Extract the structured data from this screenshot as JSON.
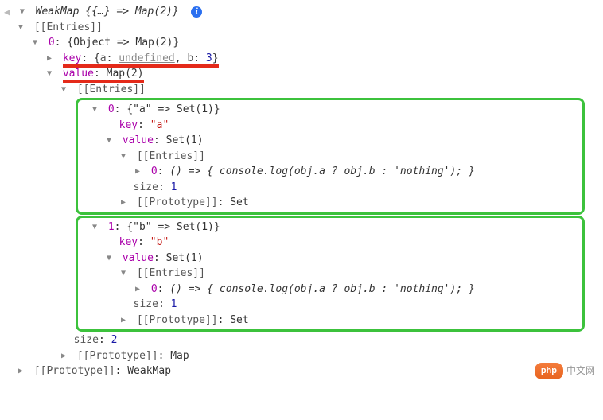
{
  "root": {
    "header": "WeakMap {{…} => Map(2)}",
    "entries_label": "[[Entries]]",
    "entry0_header": "{Object => Map(2)}",
    "key_label": "key",
    "key_preview_a": "a",
    "key_preview_und": "undefined",
    "key_preview_b": "b",
    "key_preview_bv": "3",
    "value_label": "value",
    "value_preview": "Map(2)",
    "nested": {
      "entries_label": "[[Entries]]",
      "e0": {
        "header": "{\"a\" => Set(1)}",
        "key_label": "key",
        "key_val": "\"a\"",
        "value_label": "value",
        "value_preview": "Set(1)",
        "entries_label": "[[Entries]]",
        "idx": "0",
        "fn": "() => { console.log(obj.a ? obj.b : 'nothing'); }",
        "size_label": "size",
        "size_val": "1",
        "proto_label": "[[Prototype]]",
        "proto_val": "Set"
      },
      "e1": {
        "header": "{\"b\" => Set(1)}",
        "key_label": "key",
        "key_val": "\"b\"",
        "value_label": "value",
        "value_preview": "Set(1)",
        "entries_label": "[[Entries]]",
        "idx": "0",
        "fn": "() => { console.log(obj.a ? obj.b : 'nothing'); }",
        "size_label": "size",
        "size_val": "1",
        "proto_label": "[[Prototype]]",
        "proto_val": "Set"
      },
      "outer_size_label": "size",
      "outer_size_val": "2",
      "outer_proto_label": "[[Prototype]]",
      "outer_proto_val": "Map"
    },
    "root_proto_label": "[[Prototype]]",
    "root_proto_val": "WeakMap"
  },
  "watermark": {
    "badge": "php",
    "text": "中文网"
  }
}
